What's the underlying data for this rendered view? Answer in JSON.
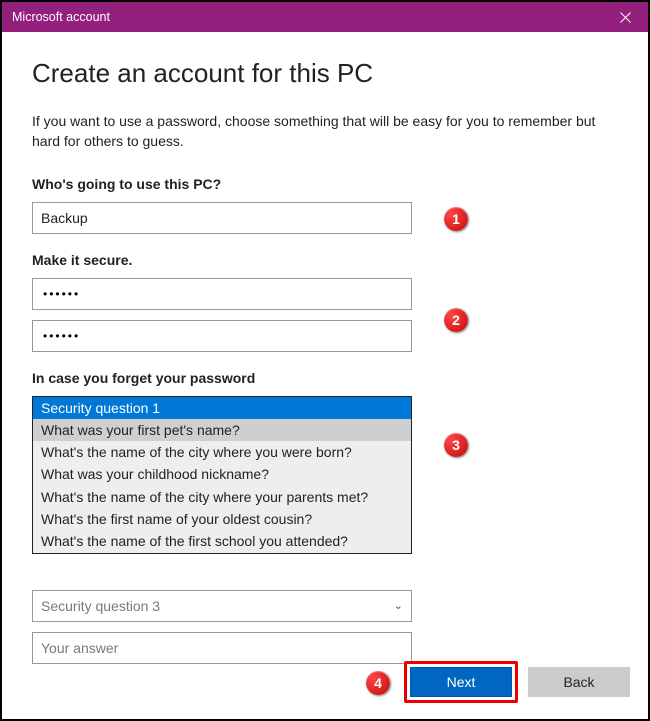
{
  "titlebar": {
    "title": "Microsoft account"
  },
  "heading": "Create an account for this PC",
  "description": "If you want to use a password, choose something that will be easy for you to remember but hard for others to guess.",
  "sections": {
    "user_label": "Who's going to use this PC?",
    "username_value": "Backup",
    "secure_label": "Make it secure.",
    "password_mask": "••••••",
    "confirm_mask": "••••••",
    "forget_label": "In case you forget your password"
  },
  "dropdown1": {
    "selected": "Security question 1",
    "options": [
      "What was your first pet's name?",
      "What's the name of the city where you were born?",
      "What was your childhood nickname?",
      "What's the name of the city where your parents met?",
      "What's the first name of your oldest cousin?",
      "What's the name of the first school you attended?"
    ]
  },
  "dropdown3": {
    "placeholder": "Security question 3"
  },
  "answer": {
    "placeholder": "Your answer"
  },
  "buttons": {
    "next": "Next",
    "back": "Back"
  },
  "badges": {
    "b1": "1",
    "b2": "2",
    "b3": "3",
    "b4": "4"
  }
}
